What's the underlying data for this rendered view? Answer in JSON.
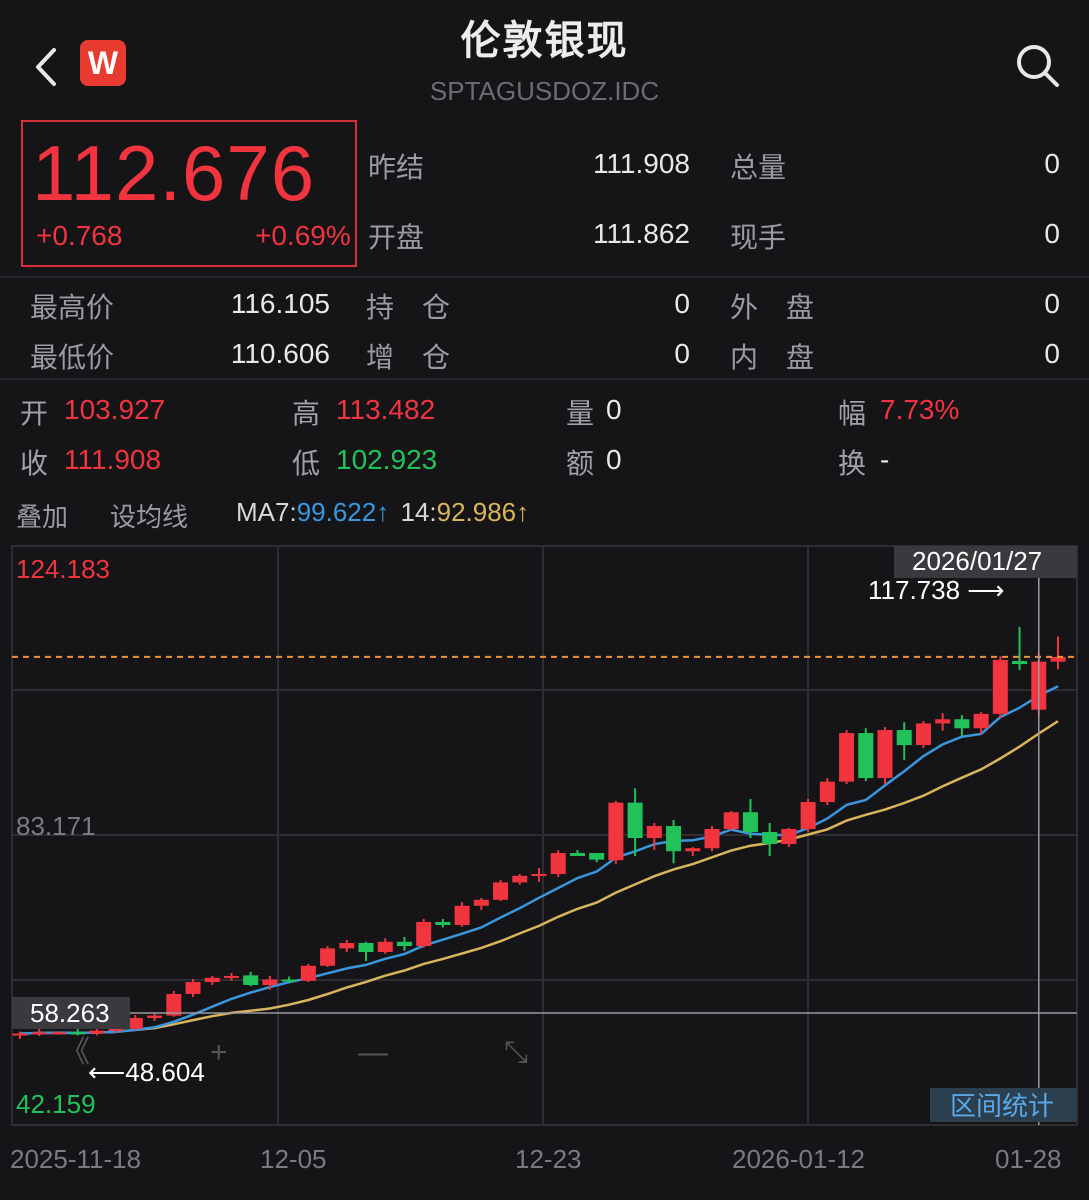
{
  "header": {
    "title": "伦敦银现",
    "symbol": "SPTAGUSDOZ.IDC",
    "logo_letter": "W"
  },
  "quote": {
    "price": "112.676",
    "change": "+0.768",
    "change_pct": "+0.69%"
  },
  "stats_top": [
    {
      "label": "昨结",
      "value": "111.908",
      "label2": "总量",
      "value2": "0"
    },
    {
      "label": "开盘",
      "value": "111.862",
      "label2": "现手",
      "value2": "0"
    }
  ],
  "stats_mid": [
    {
      "label": "最高价",
      "value": "116.105",
      "label2": "持　仓",
      "value2": "0",
      "label3": "外　盘",
      "value3": "0"
    },
    {
      "label": "最低价",
      "value": "110.606",
      "label2": "增　仓",
      "value2": "0",
      "label3": "内　盘",
      "value3": "0"
    }
  ],
  "ohlc": {
    "open_label": "开",
    "open": "103.927",
    "high_label": "高",
    "high": "113.482",
    "vol_label": "量",
    "vol": "0",
    "amp_label": "幅",
    "amp": "7.73%",
    "close_label": "收",
    "close": "111.908",
    "low_label": "低",
    "low": "102.923",
    "amt_label": "额",
    "amt": "0",
    "turn_label": "换",
    "turn": "-"
  },
  "ma": {
    "overlay": "叠加",
    "setting": "设均线",
    "ma7_label": "MA7:",
    "ma7": "99.622↑",
    "ma14_label": "14:",
    "ma14": "92.986↑",
    "ma7_color": "#3a96dd",
    "ma14_color": "#d9b45a"
  },
  "chart": {
    "y_top": "124.183",
    "y_mid": "83.171",
    "y_cross": "58.263",
    "y_bottom": "42.159",
    "hover_date": "2026/01/27",
    "max_marker": "117.738 ⟶",
    "min_marker": "⟵48.604",
    "range_stat": "区间统计",
    "x_labels": [
      "2025-11-18",
      "12-05",
      "12-23",
      "2026-01-12",
      "01-28"
    ],
    "up_color": "#f2343f",
    "down_color": "#22c25a"
  },
  "chart_data": {
    "type": "candlestick",
    "ylim": [
      42.159,
      124.183
    ],
    "candles": [
      [
        49.6,
        50.2,
        49.0,
        49.9
      ],
      [
        49.9,
        51.0,
        49.5,
        50.1
      ],
      [
        50.0,
        50.3,
        49.7,
        50.1
      ],
      [
        50.1,
        50.7,
        49.6,
        49.9
      ],
      [
        49.9,
        50.8,
        49.6,
        50.4
      ],
      [
        50.4,
        51.0,
        50.0,
        50.7
      ],
      [
        50.7,
        53.0,
        50.5,
        52.5
      ],
      [
        52.5,
        53.3,
        52.0,
        52.9
      ],
      [
        52.9,
        57.0,
        52.7,
        56.5
      ],
      [
        56.5,
        59.0,
        56.0,
        58.5
      ],
      [
        58.5,
        59.5,
        58.0,
        59.2
      ],
      [
        59.2,
        60.0,
        58.7,
        59.5
      ],
      [
        59.6,
        60.2,
        57.8,
        58.0
      ],
      [
        58.0,
        59.5,
        57.2,
        58.9
      ],
      [
        58.9,
        59.4,
        58.3,
        58.7
      ],
      [
        58.7,
        61.5,
        58.5,
        61.2
      ],
      [
        61.2,
        64.5,
        61.0,
        64.1
      ],
      [
        64.1,
        65.5,
        63.5,
        65.0
      ],
      [
        65.0,
        65.2,
        62.0,
        63.5
      ],
      [
        63.5,
        65.8,
        63.2,
        65.2
      ],
      [
        65.2,
        66.0,
        63.7,
        64.5
      ],
      [
        64.5,
        69.0,
        64.2,
        68.5
      ],
      [
        68.5,
        69.0,
        67.6,
        68.0
      ],
      [
        68.0,
        71.8,
        67.7,
        71.2
      ],
      [
        71.2,
        72.5,
        70.5,
        72.2
      ],
      [
        72.2,
        75.5,
        72.0,
        75.1
      ],
      [
        75.1,
        76.5,
        74.7,
        76.2
      ],
      [
        76.2,
        77.5,
        75.2,
        76.5
      ],
      [
        76.5,
        80.5,
        76.0,
        80.0
      ],
      [
        80.0,
        80.5,
        85.0,
        79.5
      ],
      [
        80.0,
        79.8,
        78.5,
        78.9
      ],
      [
        78.8,
        88.7,
        78.2,
        88.4
      ],
      [
        88.4,
        90.8,
        79.5,
        82.5
      ],
      [
        82.5,
        85.0,
        80.5,
        84.5
      ],
      [
        84.5,
        85.5,
        78.3,
        80.3
      ],
      [
        80.3,
        81.0,
        79.5,
        80.8
      ],
      [
        80.8,
        84.5,
        80.3,
        84.0
      ],
      [
        84.0,
        87.0,
        83.8,
        86.8
      ],
      [
        86.8,
        89.0,
        82.5,
        83.5
      ],
      [
        83.5,
        85.0,
        79.5,
        81.5
      ],
      [
        81.5,
        84.2,
        81.0,
        84.0
      ],
      [
        84.0,
        89.0,
        83.5,
        88.5
      ],
      [
        88.5,
        92.5,
        88.0,
        91.9
      ],
      [
        91.9,
        100.5,
        91.5,
        100.0
      ],
      [
        100.0,
        100.8,
        92.0,
        92.5
      ],
      [
        92.5,
        101.0,
        91.5,
        100.5
      ],
      [
        100.5,
        101.8,
        95.5,
        98.0
      ],
      [
        98.0,
        102.0,
        97.5,
        101.6
      ],
      [
        101.6,
        103.3,
        100.4,
        102.3
      ],
      [
        102.3,
        103.0,
        99.5,
        100.8
      ],
      [
        100.8,
        103.5,
        99.8,
        103.2
      ],
      [
        103.2,
        112.8,
        102.5,
        112.2
      ],
      [
        112.0,
        117.7,
        110.5,
        111.5
      ],
      [
        103.9,
        113.5,
        102.9,
        111.9
      ],
      [
        111.9,
        116.1,
        110.6,
        112.7
      ]
    ]
  }
}
